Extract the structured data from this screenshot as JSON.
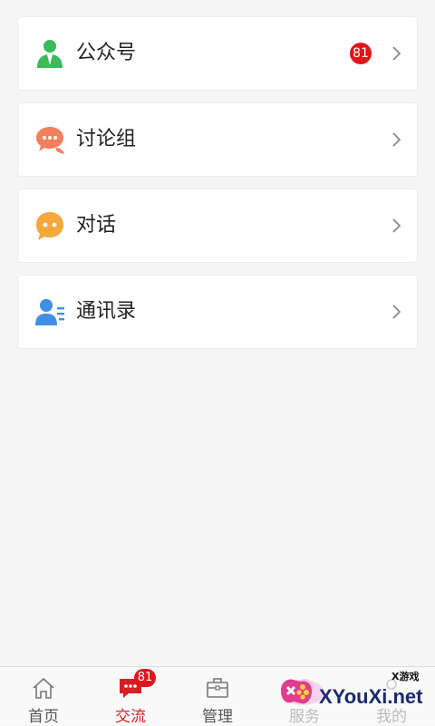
{
  "list": {
    "items": [
      {
        "label": "公众号",
        "icon": "official-account-icon",
        "badge": "81"
      },
      {
        "label": "讨论组",
        "icon": "group-chat-icon"
      },
      {
        "label": "对话",
        "icon": "chat-bubble-icon"
      },
      {
        "label": "通讯录",
        "icon": "contacts-icon"
      }
    ]
  },
  "tabbar": {
    "tabs": [
      {
        "label": "首页",
        "icon": "home-icon"
      },
      {
        "label": "交流",
        "icon": "message-icon",
        "badge": "81",
        "active": true
      },
      {
        "label": "管理",
        "icon": "briefcase-icon"
      },
      {
        "label": "服务",
        "icon": "service-icon"
      },
      {
        "label": "我的",
        "icon": "profile-icon"
      }
    ]
  },
  "watermark": {
    "text": "XYouXi.net",
    "sub": "X游戏"
  },
  "colors": {
    "accent": "#d81e24",
    "badge": "#e0161b",
    "background": "#f5f5f5"
  }
}
